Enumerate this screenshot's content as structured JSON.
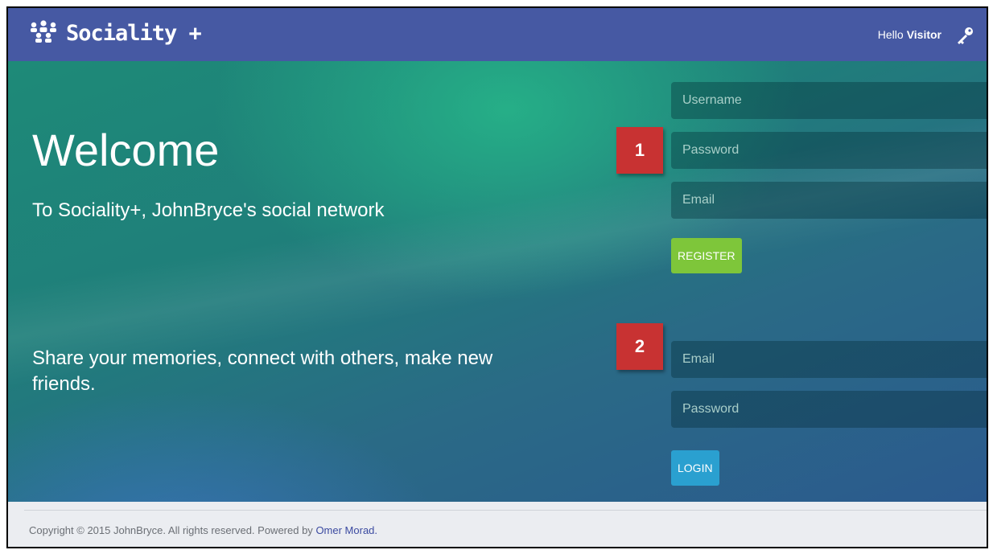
{
  "navbar": {
    "brand": "Sociality +",
    "greeting": "Hello",
    "user": "Visitor",
    "icons": {
      "brand": "people-group-icon",
      "key": "key-icon"
    }
  },
  "hero": {
    "title": "Welcome",
    "subtitle": "To Sociality+, JohnBryce's social network",
    "tagline": "Share your memories, connect with others, make new friends."
  },
  "register": {
    "badge": "1",
    "username_placeholder": "Username",
    "password_placeholder": "Password",
    "email_placeholder": "Email",
    "button": "REGISTER"
  },
  "login": {
    "badge": "2",
    "email_placeholder": "Email",
    "password_placeholder": "Password",
    "button": "LOGIN"
  },
  "footer": {
    "text": "Copyright © 2015 JohnBryce. All rights reserved. Powered by",
    "link": "Omer Morad."
  },
  "colors": {
    "navbar": "#4659a3",
    "register_button": "#7ec63a",
    "login_button": "#2aa0d0",
    "badge": "#c83232",
    "footer_bg": "#ebedf1"
  }
}
